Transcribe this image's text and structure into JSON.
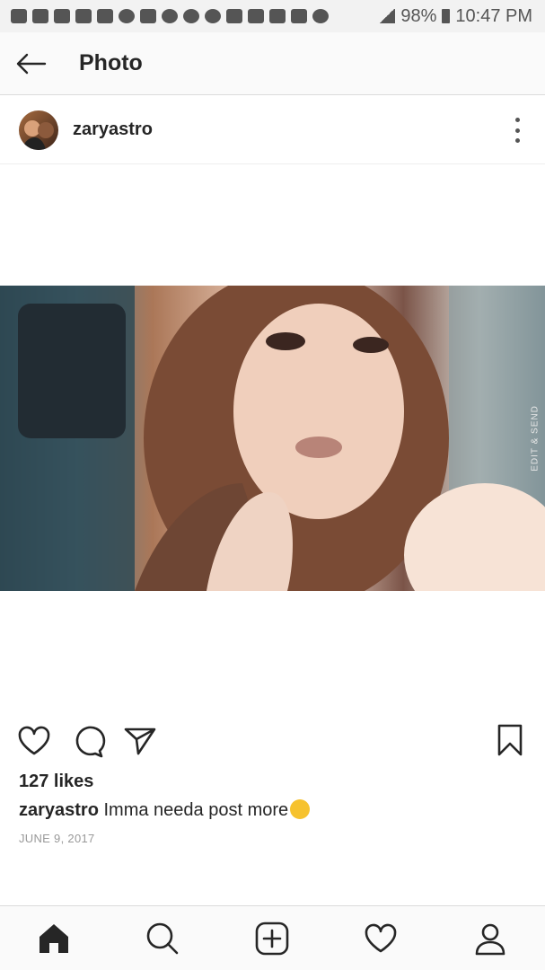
{
  "status_bar": {
    "battery": "98%",
    "time": "10:47 PM"
  },
  "header": {
    "title": "Photo"
  },
  "post": {
    "username": "zaryastro",
    "photo_overlay_text": "EDIT & SEND",
    "likes": "127 likes",
    "caption_username": "zaryastro",
    "caption_text": "Imma needa post more",
    "date": "JUNE 9, 2017"
  },
  "icons": {
    "back": "back-arrow-icon",
    "more": "more-vertical-icon",
    "like": "heart-icon",
    "comment": "comment-icon",
    "share": "send-icon",
    "save": "bookmark-icon",
    "home": "home-icon",
    "search": "search-icon",
    "add": "add-post-icon",
    "activity": "heart-icon",
    "profile": "profile-icon"
  }
}
